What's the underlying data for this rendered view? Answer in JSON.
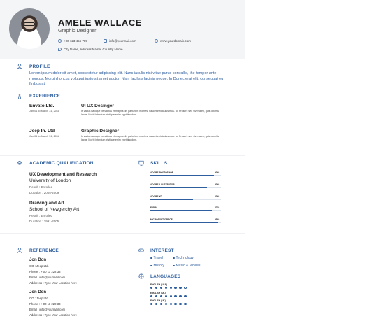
{
  "header": {
    "name": "AMELE WALLACE",
    "role": "Graphic Designer",
    "phone": "+00 123 456 789",
    "email": "info@yourmail.com",
    "website": "www.yourdomain.com",
    "address": "City Name, Address Name, Country Name"
  },
  "profile": {
    "title": "PROFILE",
    "text": "Lorem ipsum dolor sit amet, consectetur adipiscing elit. Nunc iaculis nisi vitae purus convallis, the tempor ante rhoncus. Morbi rhoncus volutpat justo sit amet auctor. Nam facilisis lacinia neque. In Donec erat elit, consequat eu finibus at."
  },
  "experience": {
    "title": "EXPERIENCE",
    "jobs": [
      {
        "company": "Envato Ltd.",
        "date": "Jan 01 to March 31, 2018",
        "title": "UI UX Desinger",
        "desc": "Is varius natoque penatibus et magnis dis parturient montes, nascetur ridiculus mus. for Proserit sed viverra ex, quis lobortis lacus. Morbi interdum tristique enim eget tincidunt."
      },
      {
        "company": "Jeep In. Ltd",
        "date": "Jan 01 to March 31, 2018",
        "title": "Graphic Designer",
        "desc": "Is varius natoque penatibus et magnis dis parturient montes, nascetur ridiculus mus. for Proserit sed viverra ex, quis lobortis lacus. Morbi interdum tristique enim eget tincidunt."
      }
    ]
  },
  "education": {
    "title": "ACADEMIC QUALIFICATION",
    "items": [
      {
        "degree": "UX Development and Research",
        "school": "University of London",
        "result": "Result : Enrolled",
        "duration": "Duration : 2005-2009"
      },
      {
        "degree": "Drawing and Art",
        "school": "School of Newgerchy Art",
        "result": "Result : Enrolled",
        "duration": "Duration : 1991-2005"
      }
    ]
  },
  "skills": {
    "title": "SKILLS",
    "items": [
      {
        "name": "ADOBE PHOTOSHOP",
        "pct_label": "90%",
        "level": 0.9
      },
      {
        "name": "ADOBE ILLUSTRATOR",
        "pct_label": "80%",
        "level": 0.8
      },
      {
        "name": "ADOBE XD",
        "pct_label": "60%",
        "level": 0.6
      },
      {
        "name": "FIGMA",
        "pct_label": "87%",
        "level": 0.87
      },
      {
        "name": "MICROSOFT OFFICE",
        "pct_label": "95%",
        "level": 0.95
      }
    ]
  },
  "reference": {
    "title": "REFERENCE",
    "items": [
      {
        "name": "Jon Don",
        "co": "CO : Jeep Ltd.",
        "phone": "Phone : + 00 11 222 33",
        "email": "Email : info@yourmail.com",
        "address": "Addoress : Type Your Location here"
      },
      {
        "name": "Jon Don",
        "co": "CO : Jeep Ltd.",
        "phone": "Phone : + 00 11 222 33",
        "email": "Email : info@yourmail.com",
        "address": "Addoress : Type Your Location here"
      }
    ]
  },
  "interest": {
    "title": "INTEREST",
    "items": [
      "Travel",
      "Technology",
      "History",
      "Music & Movies"
    ]
  },
  "languages": {
    "title": "LANGUAGES",
    "items": [
      {
        "name": "ENGLISH (USA)",
        "level": 7,
        "total": 8
      },
      {
        "name": "ENGLISH (UK)",
        "level": 8,
        "total": 8
      },
      {
        "name": "ENGLISH (UK)",
        "level": 8,
        "total": 8
      }
    ]
  },
  "colors": {
    "accent": "#2e5e9e",
    "header_bg": "#f4f5f7"
  }
}
